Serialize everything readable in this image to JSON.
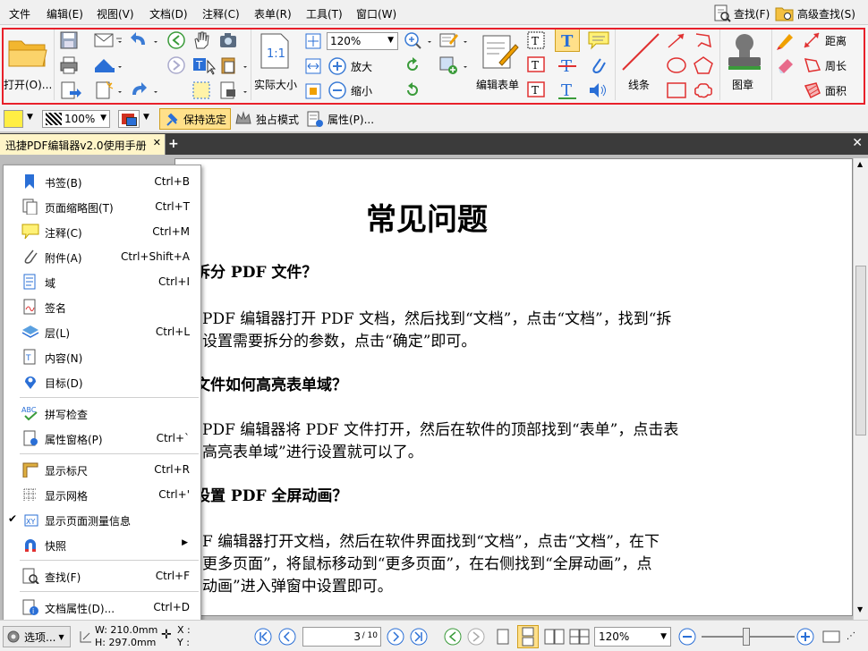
{
  "menubar": {
    "items": [
      "文件",
      "编辑(E)",
      "视图(V)",
      "文档(D)",
      "注释(C)",
      "表单(R)",
      "工具(T)",
      "窗口(W)"
    ],
    "find": "查找(F)",
    "advanced_find": "高级查找(S)"
  },
  "ribbon": {
    "open": "打开(O)...",
    "zoom_value": "120%",
    "actual_size": "实际大小",
    "zoom_in": "放大",
    "zoom_out": "缩小",
    "edit_form": "编辑表单",
    "line": "线条",
    "stamp": "图章",
    "distance": "距离",
    "perimeter": "周长",
    "area": "面积"
  },
  "toolbar2": {
    "opacity": "100%",
    "keep_selected": "保持选定",
    "exclusive_mode": "独占模式",
    "properties": "属性(P)..."
  },
  "tab": {
    "title": "迅捷PDF编辑器v2.0使用手册"
  },
  "popup": {
    "items": [
      {
        "label": "书签(B)",
        "shortcut": "Ctrl+B"
      },
      {
        "label": "页面缩略图(T)",
        "shortcut": "Ctrl+T"
      },
      {
        "label": "注释(C)",
        "shortcut": "Ctrl+M"
      },
      {
        "label": "附件(A)",
        "shortcut": "Ctrl+Shift+A"
      },
      {
        "label": "域",
        "shortcut": "Ctrl+I"
      },
      {
        "label": "签名",
        "shortcut": ""
      },
      {
        "label": "层(L)",
        "shortcut": "Ctrl+L"
      },
      {
        "label": "内容(N)",
        "shortcut": ""
      },
      {
        "label": "目标(D)",
        "shortcut": ""
      },
      {
        "label": "拼写检查",
        "shortcut": ""
      },
      {
        "label": "属性窗格(P)",
        "shortcut": "Ctrl+`"
      },
      {
        "label": "显示标尺",
        "shortcut": "Ctrl+R"
      },
      {
        "label": "显示网格",
        "shortcut": "Ctrl+'"
      },
      {
        "label": "显示页面测量信息",
        "shortcut": ""
      },
      {
        "label": "快照",
        "shortcut": ""
      },
      {
        "label": "查找(F)",
        "shortcut": "Ctrl+F"
      },
      {
        "label": "文档属性(D)...",
        "shortcut": "Ctrl+D"
      }
    ]
  },
  "doc": {
    "title": "常见问题",
    "q1": "拆分 PDF 文件？",
    "a1_line1": "PDF 编辑器打开 PDF 文档，然后找到“文档”，点击“文档”，找到“拆",
    "a1_line2": "设置需要拆分的参数，点击“确定”即可。",
    "q2": "文件如何高亮表单域？",
    "a2_line1": "PDF 编辑器将 PDF 文件打开，然后在软件的顶部找到“表单”，点击表",
    "a2_line2": "高亮表单域”进行设置就可以了。",
    "q3": "设置 PDF 全屏动画？",
    "a3_line1": "F 编辑器打开文档，然后在软件界面找到“文档”，点击“文档”，在下",
    "a3_line2": "更多页面”，将鼠标移动到“更多页面”，在右侧找到“全屏动画”，点",
    "a3_line3": "动画”进入弹窗中设置即可。"
  },
  "status": {
    "options": "选项...",
    "width": "W: 210.0mm",
    "height": "H: 297.0mm",
    "x": "X :",
    "y": "Y :",
    "page": "3",
    "page_total": "/ 10",
    "zoom": "120%"
  },
  "colors": {
    "ribbon_highlight": "#e8202a",
    "tab_bg": "#fff5c8",
    "accent_blue": "#2a6fd6",
    "annotation_red": "#e03030"
  }
}
